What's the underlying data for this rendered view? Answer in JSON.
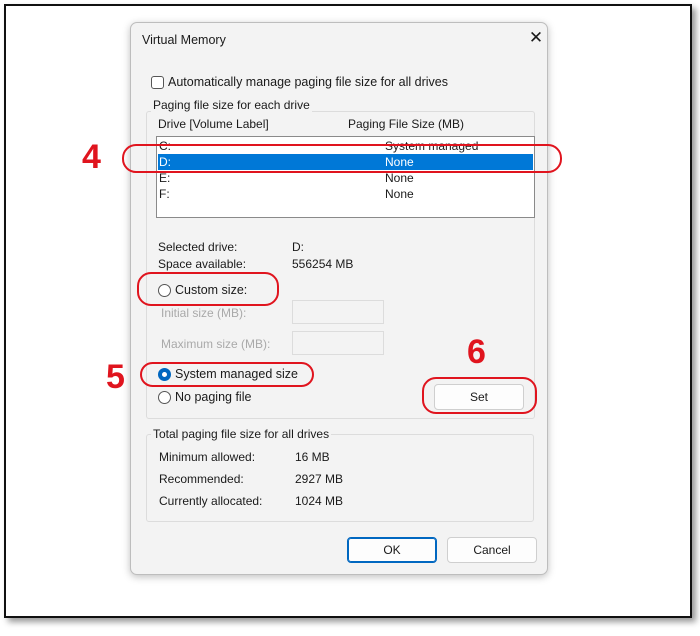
{
  "dialog": {
    "title": "Virtual Memory",
    "close_icon": "close-icon",
    "auto_manage": {
      "label": "Automatically manage paging file size for all drives",
      "checked": false
    },
    "per_drive": {
      "legend": "Paging file size for each drive",
      "headers": [
        "Drive  [Volume Label]",
        "Paging File Size (MB)"
      ],
      "drives": [
        {
          "drive": "C:",
          "size": "System managed",
          "selected": false
        },
        {
          "drive": "D:",
          "size": "None",
          "selected": true
        },
        {
          "drive": "E:",
          "size": "None",
          "selected": false
        },
        {
          "drive": "F:",
          "size": "None",
          "selected": false
        }
      ],
      "selected_drive_label": "Selected drive:",
      "selected_drive_value": "D:",
      "space_label": "Space available:",
      "space_value": "556254 MB",
      "custom_size": "Custom size:",
      "initial_size": "Initial size (MB):",
      "maximum_size": "Maximum size (MB):",
      "system_managed": "System managed size",
      "no_paging": "No paging file",
      "selected_option": "System managed size",
      "set": "Set"
    },
    "totals": {
      "legend": "Total paging file size for all drives",
      "rows": [
        {
          "label": "Minimum allowed:",
          "value": "16 MB"
        },
        {
          "label": "Recommended:",
          "value": "2927 MB"
        },
        {
          "label": "Currently allocated:",
          "value": "1024 MB"
        }
      ]
    },
    "ok": "OK",
    "cancel": "Cancel"
  },
  "annotations": {
    "step4": "4",
    "step5": "5",
    "step6": "6",
    "color": "#e0141e"
  }
}
